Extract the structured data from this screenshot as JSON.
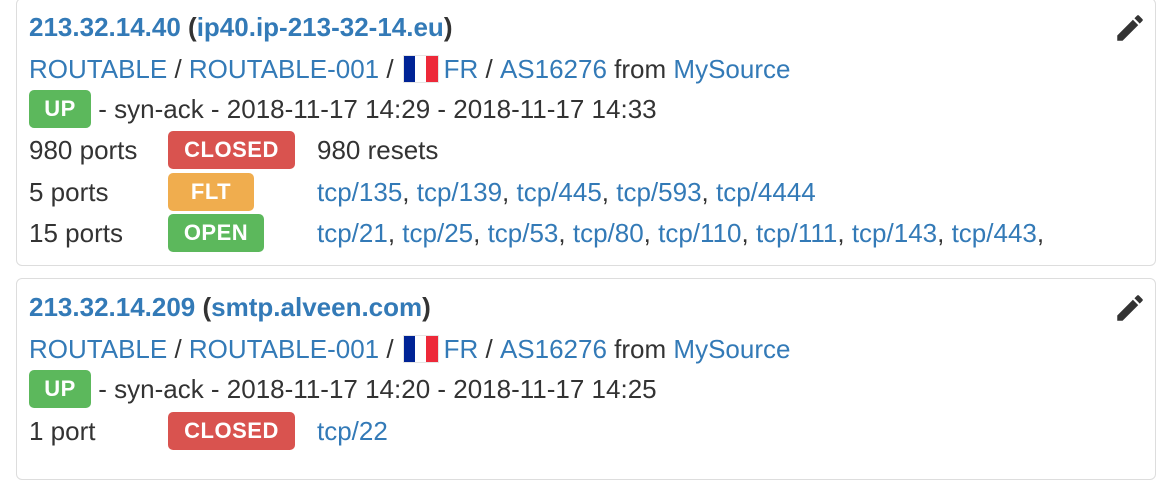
{
  "colors": {
    "link": "#337ab7",
    "text": "#333333",
    "up": "#5cb85c",
    "closed": "#d9534f",
    "filtered": "#f0ad4e",
    "open": "#5cb85c",
    "flag_fr": [
      "#002395",
      "#ffffff",
      "#ed2939"
    ]
  },
  "icons": {
    "edit": "pencil-icon",
    "flag": "flag-fr-icon"
  },
  "hosts": [
    {
      "ip": "213.32.14.40",
      "hostname": "ip40.ip-213-32-14.eu",
      "category1": "ROUTABLE",
      "category2": "ROUTABLE-001",
      "country": "FR",
      "asn": "AS16276",
      "from_word": "from",
      "source": "MySource",
      "status": "UP",
      "reason": "syn-ack",
      "start": "2018-11-17 14:29",
      "end": "2018-11-17 14:33",
      "ports": [
        {
          "count": "980 ports",
          "state": "CLOSED",
          "extra": "980 resets",
          "list": []
        },
        {
          "count": "5 ports",
          "state": "FLT",
          "list": [
            "tcp/135",
            "tcp/139",
            "tcp/445",
            "tcp/593",
            "tcp/4444"
          ]
        },
        {
          "count": "15 ports",
          "state": "OPEN",
          "list": [
            "tcp/21",
            "tcp/25",
            "tcp/53",
            "tcp/80",
            "tcp/110",
            "tcp/111",
            "tcp/143",
            "tcp/443"
          ]
        }
      ]
    },
    {
      "ip": "213.32.14.209",
      "hostname": "smtp.alveen.com",
      "category1": "ROUTABLE",
      "category2": "ROUTABLE-001",
      "country": "FR",
      "asn": "AS16276",
      "from_word": "from",
      "source": "MySource",
      "status": "UP",
      "reason": "syn-ack",
      "start": "2018-11-17 14:20",
      "end": "2018-11-17 14:25",
      "ports": [
        {
          "count": "1 port",
          "state": "CLOSED",
          "list": [
            "tcp/22"
          ]
        }
      ]
    }
  ]
}
